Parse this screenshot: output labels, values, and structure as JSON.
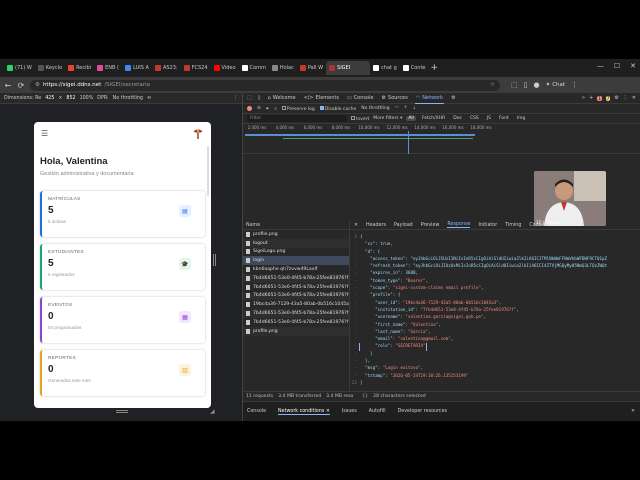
{
  "browser": {
    "tabs": [
      {
        "label": "(71) W",
        "color": "#25d366",
        "active": false
      },
      {
        "label": "Keyclo",
        "color": "#555555",
        "active": false
      },
      {
        "label": "Recibi",
        "color": "#ea4335",
        "active": false
      },
      {
        "label": "ENB (",
        "color": "#e04b9b",
        "active": false
      },
      {
        "label": "LUIS A",
        "color": "#4285f4",
        "active": false
      },
      {
        "label": "AS23:",
        "color": "#c0392b",
        "active": false
      },
      {
        "label": "FCS24",
        "color": "#c0392b",
        "active": false
      },
      {
        "label": "Video",
        "color": "#ff0000",
        "active": false
      },
      {
        "label": "Comm",
        "color": "#ffffff",
        "active": false
      },
      {
        "label": "Holac",
        "color": "#888888",
        "active": false
      },
      {
        "label": "Pall W",
        "color": "#c0392b",
        "active": false
      },
      {
        "label": "SIGEI",
        "color": "#a33",
        "active": true
      },
      {
        "label": "chat g",
        "color": "#ffffff",
        "active": false
      },
      {
        "label": "Conte",
        "color": "#ffffff",
        "active": false
      }
    ],
    "new_tab": "+",
    "url_host": "https://sigei.ddns.net",
    "url_path": "/SIGEI/secretaria",
    "chat_label": "Chat"
  },
  "device_toolbar": {
    "dimensions_label": "Dimensions: Re",
    "width": "425",
    "times": "×",
    "height": "852",
    "zoom": "100%",
    "dpr_label": "DPR: ",
    "throttle": "No throttling"
  },
  "app": {
    "greeting": "Hola, Valentina",
    "subtitle": "Gestión administrativa y documentaria",
    "cards": [
      {
        "title": "MATRÍCULAS",
        "value": "5",
        "sub": "5 activas",
        "icon": "▤"
      },
      {
        "title": "ESTUDIANTES",
        "value": "5",
        "sub": "5 registrados",
        "icon": "🎓"
      },
      {
        "title": "EVENTOS",
        "value": "0",
        "sub": "54 programados",
        "icon": "▦"
      },
      {
        "title": "REPORTES",
        "value": "0",
        "sub": "Generados este mes",
        "icon": "▥"
      }
    ]
  },
  "devtools": {
    "tabs": [
      "Welcome",
      "Elements",
      "Console",
      "Sources",
      "Network",
      "Performance"
    ],
    "active_tab": "Network",
    "error_count": "1",
    "warn_count": "7",
    "toolbar": {
      "preserve_log": "Preserve log",
      "disable_cache": "Disable cache",
      "throttle": "No throttling"
    },
    "filter": {
      "placeholder": "Filter",
      "invert": "Invert",
      "more_filters": "More filters ▾",
      "types": [
        "All",
        "Fetch/XHR",
        "Doc",
        "CSS",
        "JS",
        "Font",
        "Img"
      ]
    },
    "timeline_ticks": [
      "2,000 ms",
      "4,000 ms",
      "6,000 ms",
      "8,000 ms",
      "10,000 ms",
      "12,000 ms",
      "14,000 ms",
      "16,000 ms",
      "18,000 ms"
    ],
    "camera_label": "37_LuisVelar",
    "requests_header": "Name",
    "requests": [
      {
        "name": "profile.png",
        "selected": false
      },
      {
        "name": "logout",
        "selected": false
      },
      {
        "name": "SigeiLogo.png",
        "selected": false
      },
      {
        "name": "login",
        "selected": true
      },
      {
        "name": "kbn6aaphe qh7zvvw49LaxIf",
        "selected": false
      },
      {
        "name": "7b4d6651-53e0-4f45-b78a-25fee81976?f",
        "selected": false
      },
      {
        "name": "7b4d6651-53e0-4f45-b78a-25fee81976?f",
        "selected": false
      },
      {
        "name": "7b4d6651-53e0-4f45-b78a-25fee81976?f",
        "selected": false
      },
      {
        "name": "19bc4a36-7129-43a5-80ab-0b516c1045a3",
        "selected": false
      },
      {
        "name": "7b4d6651-53e0-4f45-b78a-25fee81976?f",
        "selected": false
      },
      {
        "name": "7b4d6651-53e0-4f45-b78a-25fee81976?f",
        "selected": false
      },
      {
        "name": "profile.png",
        "selected": false
      }
    ],
    "response_tabs": [
      "Headers",
      "Payload",
      "Preview",
      "Response",
      "Initiator",
      "Timing",
      "Cookies"
    ],
    "active_response_tab": "Response",
    "response_lines": [
      "{",
      "  \"ss\": true,",
      "  \"d\": {",
      "    \"access_token\": \"eyJhbGciOiJSUzI1NiIsInR5cCIgOiAiSldUIiwia2lkIiA6ICJTMlNkWmFFNmVhbWFDWF9CT01pZ",
      "    \"refresh_token\": \"eyJhbGciOiJIUzUxMiIsInR5cCIgOiAiSldUIiwia2lkIiA6ICI4ZTVjMGQyMy05NmQ3LTQzZWQt",
      "    \"expires_in\": 3600,",
      "    \"token_type\": \"Bearer\",",
      "    \"scope\": \"sigei-custom-claims email profile\",",
      "    \"profile\": {",
      "      \"user_id\": \"19bc4a36-7129-43a5-80ab-0b516c1045a3\",",
      "      \"institution_id\": \"7fb4d651-53e0-4f45-b78a-25fee81976?f\",",
      "      \"username\": \"valentina.garcia@sigei.gob.pe\",",
      "      \"first_name\": \"Valentina\",",
      "      \"last_name\": \"Garcia\",",
      "      \"email\": \"valentina@gmail.com\",",
      "      \"role\": \"SECRETARIA\"",
      "    }",
      "  },",
      "  \"msg\": \"Login exitoso\",",
      "  \"tstamp\": \"2026-05-24T19:10:26.135153199\"",
      "}"
    ],
    "status": {
      "requests": "11 requests",
      "transferred": "3.4 MB transferred",
      "resources": "3.4 MB reso",
      "selected": "28 characters selected"
    },
    "drawer_tabs": [
      "Console",
      "Network conditions",
      "Issues",
      "Autofill",
      "Developer resources"
    ],
    "active_drawer_tab": "Network conditions"
  }
}
